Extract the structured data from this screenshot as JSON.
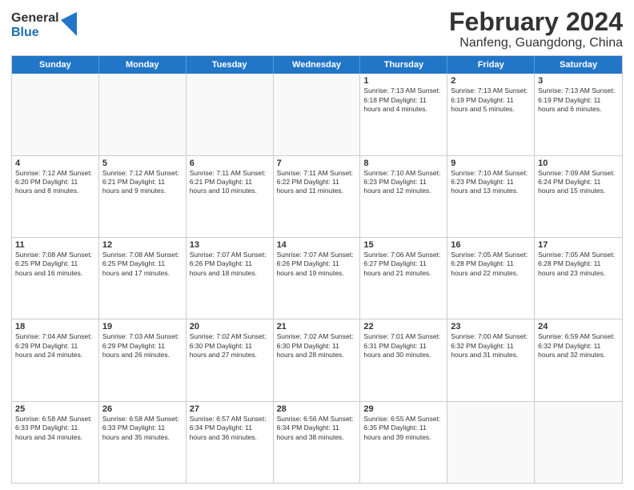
{
  "logo": {
    "general": "General",
    "blue": "Blue"
  },
  "title": "February 2024",
  "subtitle": "Nanfeng, Guangdong, China",
  "headers": [
    "Sunday",
    "Monday",
    "Tuesday",
    "Wednesday",
    "Thursday",
    "Friday",
    "Saturday"
  ],
  "weeks": [
    [
      {
        "day": "",
        "info": ""
      },
      {
        "day": "",
        "info": ""
      },
      {
        "day": "",
        "info": ""
      },
      {
        "day": "",
        "info": ""
      },
      {
        "day": "1",
        "info": "Sunrise: 7:13 AM\nSunset: 6:18 PM\nDaylight: 11 hours\nand 4 minutes."
      },
      {
        "day": "2",
        "info": "Sunrise: 7:13 AM\nSunset: 6:19 PM\nDaylight: 11 hours\nand 5 minutes."
      },
      {
        "day": "3",
        "info": "Sunrise: 7:13 AM\nSunset: 6:19 PM\nDaylight: 11 hours\nand 6 minutes."
      }
    ],
    [
      {
        "day": "4",
        "info": "Sunrise: 7:12 AM\nSunset: 6:20 PM\nDaylight: 11 hours\nand 8 minutes."
      },
      {
        "day": "5",
        "info": "Sunrise: 7:12 AM\nSunset: 6:21 PM\nDaylight: 11 hours\nand 9 minutes."
      },
      {
        "day": "6",
        "info": "Sunrise: 7:11 AM\nSunset: 6:21 PM\nDaylight: 11 hours\nand 10 minutes."
      },
      {
        "day": "7",
        "info": "Sunrise: 7:11 AM\nSunset: 6:22 PM\nDaylight: 11 hours\nand 11 minutes."
      },
      {
        "day": "8",
        "info": "Sunrise: 7:10 AM\nSunset: 6:23 PM\nDaylight: 11 hours\nand 12 minutes."
      },
      {
        "day": "9",
        "info": "Sunrise: 7:10 AM\nSunset: 6:23 PM\nDaylight: 11 hours\nand 13 minutes."
      },
      {
        "day": "10",
        "info": "Sunrise: 7:09 AM\nSunset: 6:24 PM\nDaylight: 11 hours\nand 15 minutes."
      }
    ],
    [
      {
        "day": "11",
        "info": "Sunrise: 7:08 AM\nSunset: 6:25 PM\nDaylight: 11 hours\nand 16 minutes."
      },
      {
        "day": "12",
        "info": "Sunrise: 7:08 AM\nSunset: 6:25 PM\nDaylight: 11 hours\nand 17 minutes."
      },
      {
        "day": "13",
        "info": "Sunrise: 7:07 AM\nSunset: 6:26 PM\nDaylight: 11 hours\nand 18 minutes."
      },
      {
        "day": "14",
        "info": "Sunrise: 7:07 AM\nSunset: 6:26 PM\nDaylight: 11 hours\nand 19 minutes."
      },
      {
        "day": "15",
        "info": "Sunrise: 7:06 AM\nSunset: 6:27 PM\nDaylight: 11 hours\nand 21 minutes."
      },
      {
        "day": "16",
        "info": "Sunrise: 7:05 AM\nSunset: 6:28 PM\nDaylight: 11 hours\nand 22 minutes."
      },
      {
        "day": "17",
        "info": "Sunrise: 7:05 AM\nSunset: 6:28 PM\nDaylight: 11 hours\nand 23 minutes."
      }
    ],
    [
      {
        "day": "18",
        "info": "Sunrise: 7:04 AM\nSunset: 6:29 PM\nDaylight: 11 hours\nand 24 minutes."
      },
      {
        "day": "19",
        "info": "Sunrise: 7:03 AM\nSunset: 6:29 PM\nDaylight: 11 hours\nand 26 minutes."
      },
      {
        "day": "20",
        "info": "Sunrise: 7:02 AM\nSunset: 6:30 PM\nDaylight: 11 hours\nand 27 minutes."
      },
      {
        "day": "21",
        "info": "Sunrise: 7:02 AM\nSunset: 6:30 PM\nDaylight: 11 hours\nand 28 minutes."
      },
      {
        "day": "22",
        "info": "Sunrise: 7:01 AM\nSunset: 6:31 PM\nDaylight: 11 hours\nand 30 minutes."
      },
      {
        "day": "23",
        "info": "Sunrise: 7:00 AM\nSunset: 6:32 PM\nDaylight: 11 hours\nand 31 minutes."
      },
      {
        "day": "24",
        "info": "Sunrise: 6:59 AM\nSunset: 6:32 PM\nDaylight: 11 hours\nand 32 minutes."
      }
    ],
    [
      {
        "day": "25",
        "info": "Sunrise: 6:58 AM\nSunset: 6:33 PM\nDaylight: 11 hours\nand 34 minutes."
      },
      {
        "day": "26",
        "info": "Sunrise: 6:58 AM\nSunset: 6:33 PM\nDaylight: 11 hours\nand 35 minutes."
      },
      {
        "day": "27",
        "info": "Sunrise: 6:57 AM\nSunset: 6:34 PM\nDaylight: 11 hours\nand 36 minutes."
      },
      {
        "day": "28",
        "info": "Sunrise: 6:56 AM\nSunset: 6:34 PM\nDaylight: 11 hours\nand 38 minutes."
      },
      {
        "day": "29",
        "info": "Sunrise: 6:55 AM\nSunset: 6:35 PM\nDaylight: 11 hours\nand 39 minutes."
      },
      {
        "day": "",
        "info": ""
      },
      {
        "day": "",
        "info": ""
      }
    ]
  ]
}
